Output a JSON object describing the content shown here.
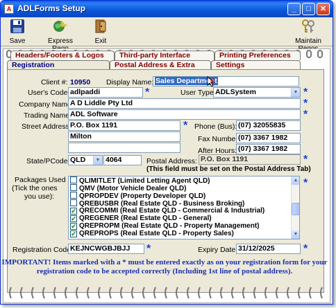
{
  "window": {
    "title": "ADLForms Setup"
  },
  "title_buttons": {
    "minimize": "_",
    "maximize": "□",
    "close": "✕"
  },
  "toolbar": {
    "save": "Save",
    "express_rego": "Express Rego",
    "exit": "Exit",
    "maintain_regos": "Maintain Regos"
  },
  "tabs": {
    "row1": [
      "Headers/Footers & Logos",
      "Third-party Interface",
      "Printing Preferences"
    ],
    "row2": [
      "Registration",
      "Postal Address & Extra Details",
      "Settings"
    ],
    "active": "Registration"
  },
  "form": {
    "client_label": "Client #:",
    "client_value": "10950",
    "display_name_label": "Display Name:",
    "display_name_value": "Sales Department",
    "users_code_label": "User's Code:",
    "users_code_value": "adlpaddi",
    "user_type_label": "User Type:",
    "user_type_value": "ADLSystem",
    "company_name_label": "Company Name:",
    "company_name_value": "A D Liddle Pty Ltd",
    "trading_name_label": "Trading Name:",
    "trading_name_value": "ADL Software",
    "street_address_label": "Street Address:",
    "street_line1": "P.O. Box 1191",
    "street_line2": "Milton",
    "street_line3": "",
    "phone_bus_label": "Phone (Bus):",
    "phone_bus_value": "(07) 32055835",
    "fax_label": "Fax Number:",
    "fax_value": "(07) 3367 1982",
    "after_hours_label": "After Hours:",
    "after_hours_value": "(07) 3367 1982",
    "state_pcode_label": "State/PCode:",
    "state_value": "QLD",
    "pcode_value": "4064",
    "postal_address_label": "Postal Address:",
    "postal_address_value": "P.O. Box 1191",
    "postal_note": "(This field must be set on the Postal Address Tab)",
    "packages_label_1": "Packages Used",
    "packages_label_2": "(Tick the ones",
    "packages_label_3": "you use):",
    "packages": [
      {
        "name": "QLIMITLET (Limited Letting Agent QLD)",
        "checked": false
      },
      {
        "name": "QMV (Motor Vehicle Dealer QLD)",
        "checked": false
      },
      {
        "name": "QPROPDEV (Property Developer QLD)",
        "checked": false
      },
      {
        "name": "QREBUSBR (Real Estate QLD - Business Broking)",
        "checked": false
      },
      {
        "name": "QRECOMMI (Real Estate QLD - Commercial & Industrial)",
        "checked": true
      },
      {
        "name": "QREGENER (Real Estate QLD - General)",
        "checked": true
      },
      {
        "name": "QREPROPM (Real Estate QLD - Property Management)",
        "checked": true
      },
      {
        "name": "QREPROPS (Real Estate QLD - Property Sales)",
        "checked": true
      }
    ],
    "registration_code_label": "Registration Code:",
    "registration_code_value": "KEJNCWGBJBJJ",
    "expiry_date_label": "Expiry Date:",
    "expiry_date_value": "31/12/2025",
    "required_marker": "*",
    "note_line1": "IMPORTANT! Items marked with a * must be entered exactly as on your registration form for your",
    "note_line2": "registration code to be accepted correctly (Including 1st line of postal address)."
  },
  "colors": {
    "accent": "#2040d0",
    "tab_text": "#800000",
    "active_tab_text": "#000080",
    "note_text": "#1a2fb0"
  }
}
